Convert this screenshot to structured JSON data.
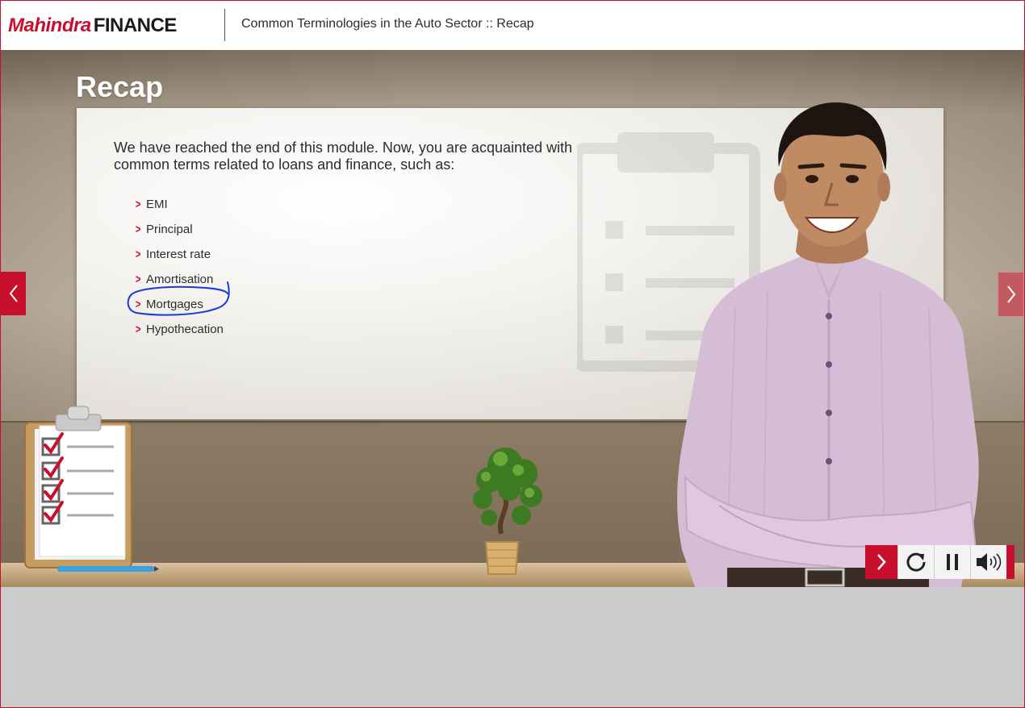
{
  "header": {
    "brand_word": "Mahindra",
    "brand_finance": "FINANCE",
    "course_title": "Common Terminologies in the Auto Sector :: Recap"
  },
  "slide": {
    "title": "Recap",
    "intro": "We have reached the end of this module. Now, you are acquainted with common terms related to loans and finance, such as:",
    "terms": [
      "EMI",
      "Principal",
      "Interest rate",
      "Amortisation",
      "Mortgages",
      "Hypothecation"
    ],
    "circled_term": "Mortgages"
  },
  "navigation": {
    "prev_icon": "chevron-left-icon",
    "next_icon": "chevron-right-icon"
  },
  "controls": {
    "next_icon": "chevron-right-icon",
    "replay_icon": "replay-icon",
    "pause_icon": "pause-icon",
    "audio_icon": "speaker-icon"
  },
  "colors": {
    "brand_red": "#c8102e",
    "annotation_blue": "#1a3ad6",
    "page_gray": "#cbcbcb"
  }
}
